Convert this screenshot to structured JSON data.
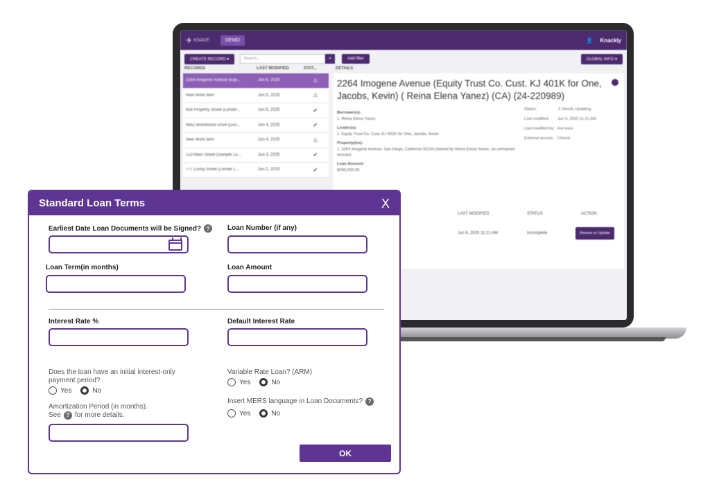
{
  "app": {
    "logo_text": "KNAVE",
    "demo_badge": "DEMO",
    "user_name": "Knackly",
    "create_record": "CREATE RECORD ▾",
    "search_placeholder": "Search...",
    "add_filter": "Add filter",
    "global_info": "GLOBAL INFO ▾",
    "headers": {
      "records": "RECORDS",
      "last_modified": "LAST MODIFIED",
      "status": "STAT...",
      "details": "DETAILS"
    },
    "records": [
      {
        "name": "2264 Imogene Avenue (Equ...",
        "date": "Jun 6, 2025",
        "status": "⚠"
      },
      {
        "name": "New Work Item",
        "date": "Jun 5, 2025",
        "status": "⚠"
      },
      {
        "name": "456 Property Street (Lendin...",
        "date": "Jun 5, 2025",
        "status": "✔"
      },
      {
        "name": "9852 Brentwood Drive (Duc...",
        "date": "Jun 4, 2025",
        "status": "✔"
      },
      {
        "name": "New Work Item",
        "date": "Jun 4, 2025",
        "status": "⚠"
      },
      {
        "name": "123 Main Street (Sample Le...",
        "date": "Jun 3, 2025",
        "status": "✔"
      },
      {
        "name": "777 Lucky Street (Lender L...",
        "date": "Jun 2, 2025",
        "status": "✔"
      }
    ],
    "details": {
      "title": "2264 Imogene Avenue (Equity Trust Co. Cust. KJ 401K for One, Jacobs, Kevin) ( Reina Elena Yanez) (CA) (24-220989)",
      "borrowers_label": "Borrower(s):",
      "borrowers_value": "1. Reina Elena Yanez",
      "lenders_label": "Lender(s):",
      "lenders_value": "1. Equity Trust Co. Cust. KJ 401K for One, Jacobs, Kevin",
      "property_label": "Property(ies):",
      "property_value": "1. 2264 Imogene Avenue, San Diego, California 92154 (owned by Reina Elena Yanez, an unmarried woman)",
      "loan_amount_label": "Loan Amount:",
      "loan_amount_value": "$260,000.00",
      "status_key": "Status:",
      "status_value": "⚠ Needs Updating",
      "last_modified_key": "Last modified:",
      "last_modified_value": "Jun 6, 2025 11:21 AM",
      "last_modified_by_key": "Last modified by:",
      "last_modified_by_value": "Kai Hara",
      "external_access_key": "External access:",
      "external_access_value": "Closed"
    },
    "task_headers": {
      "last_modified": "LAST MODIFIED",
      "status": "STATUS",
      "action": "ACTION"
    },
    "task_row": {
      "date": "Jun 6, 2025 11:21 AM",
      "status": "Incomplete",
      "action": "Review or Update"
    }
  },
  "modal": {
    "title": "Standard Loan Terms",
    "close": "X",
    "earliest_date_label": "Earliest Date Loan Documents will be Signed?",
    "loan_number_label": "Loan Number (if any)",
    "loan_term_label": "Loan Term(in months)",
    "loan_amount_label": "Loan Amount",
    "interest_rate_label": "Interest Rate %",
    "default_interest_label": "Default Interest Rate",
    "interest_only_question": "Does the loan have an initial interest-only payment period?",
    "variable_rate_question": "Variable Rate Loan? (ARM)",
    "amortization_label_1": "Amortization Period (in months).",
    "amortization_label_see": "See",
    "amortization_label_2": "for more details.",
    "mers_question": "Insert MERS language in Loan Documents?",
    "yes": "Yes",
    "no": "No",
    "help_glyph": "?",
    "ok": "OK",
    "values": {
      "earliest_date": "",
      "loan_number": "",
      "loan_term": "",
      "loan_amount": "",
      "interest_rate": "",
      "default_interest_rate": "",
      "amortization_period": "",
      "interest_only_selected": "No",
      "variable_rate_selected": "No",
      "mers_selected": "No"
    }
  },
  "colors": {
    "brand_purple": "#5e3592",
    "app_purple": "#4b2a6e",
    "selected_row": "#8e5fb6"
  }
}
